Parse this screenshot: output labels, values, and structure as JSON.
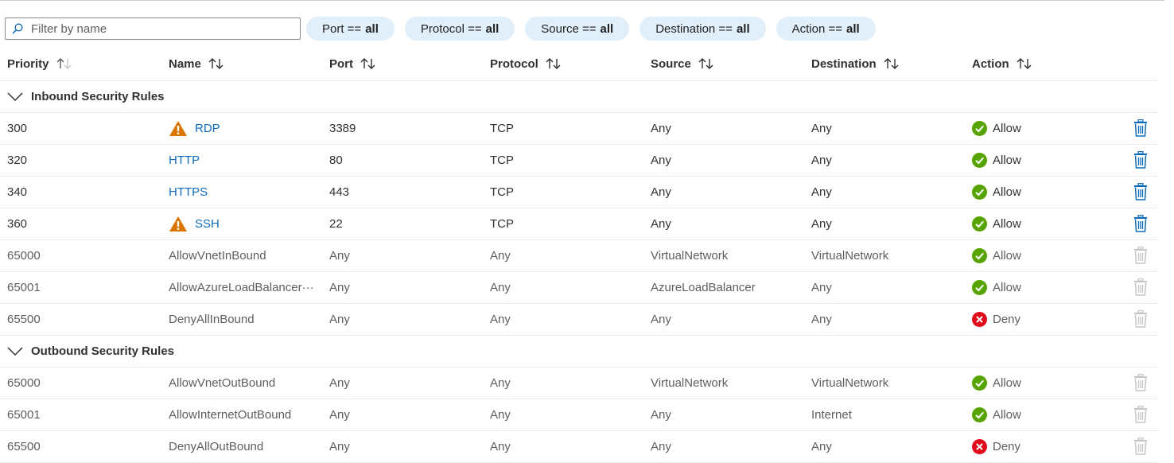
{
  "filter": {
    "placeholder": "Filter by name",
    "value": ""
  },
  "pills": [
    {
      "field": "Port",
      "op": "==",
      "value": "all"
    },
    {
      "field": "Protocol",
      "op": "==",
      "value": "all"
    },
    {
      "field": "Source",
      "op": "==",
      "value": "all"
    },
    {
      "field": "Destination",
      "op": "==",
      "value": "all"
    },
    {
      "field": "Action",
      "op": "==",
      "value": "all"
    }
  ],
  "columns": [
    "Priority",
    "Name",
    "Port",
    "Protocol",
    "Source",
    "Destination",
    "Action"
  ],
  "colors": {
    "accent": "#0f6cbd",
    "allow": "#57a300",
    "deny": "#e00b1c",
    "warning": "#db7500",
    "pill_bg": "#e1effa"
  },
  "groups": [
    {
      "title": "Inbound Security Rules",
      "rules": [
        {
          "priority": "300",
          "name": "RDP",
          "port": "3389",
          "protocol": "TCP",
          "source": "Any",
          "destination": "Any",
          "action": "Allow",
          "warning": true,
          "custom": true
        },
        {
          "priority": "320",
          "name": "HTTP",
          "port": "80",
          "protocol": "TCP",
          "source": "Any",
          "destination": "Any",
          "action": "Allow",
          "warning": false,
          "custom": true
        },
        {
          "priority": "340",
          "name": "HTTPS",
          "port": "443",
          "protocol": "TCP",
          "source": "Any",
          "destination": "Any",
          "action": "Allow",
          "warning": false,
          "custom": true
        },
        {
          "priority": "360",
          "name": "SSH",
          "port": "22",
          "protocol": "TCP",
          "source": "Any",
          "destination": "Any",
          "action": "Allow",
          "warning": true,
          "custom": true
        },
        {
          "priority": "65000",
          "name": "AllowVnetInBound",
          "port": "Any",
          "protocol": "Any",
          "source": "VirtualNetwork",
          "destination": "VirtualNetwork",
          "action": "Allow",
          "warning": false,
          "custom": false
        },
        {
          "priority": "65001",
          "name": "AllowAzureLoadBalancer···",
          "port": "Any",
          "protocol": "Any",
          "source": "AzureLoadBalancer",
          "destination": "Any",
          "action": "Allow",
          "warning": false,
          "custom": false
        },
        {
          "priority": "65500",
          "name": "DenyAllInBound",
          "port": "Any",
          "protocol": "Any",
          "source": "Any",
          "destination": "Any",
          "action": "Deny",
          "warning": false,
          "custom": false
        }
      ]
    },
    {
      "title": "Outbound Security Rules",
      "rules": [
        {
          "priority": "65000",
          "name": "AllowVnetOutBound",
          "port": "Any",
          "protocol": "Any",
          "source": "VirtualNetwork",
          "destination": "VirtualNetwork",
          "action": "Allow",
          "warning": false,
          "custom": false
        },
        {
          "priority": "65001",
          "name": "AllowInternetOutBound",
          "port": "Any",
          "protocol": "Any",
          "source": "Any",
          "destination": "Internet",
          "action": "Allow",
          "warning": false,
          "custom": false
        },
        {
          "priority": "65500",
          "name": "DenyAllOutBound",
          "port": "Any",
          "protocol": "Any",
          "source": "Any",
          "destination": "Any",
          "action": "Deny",
          "warning": false,
          "custom": false
        }
      ]
    }
  ]
}
